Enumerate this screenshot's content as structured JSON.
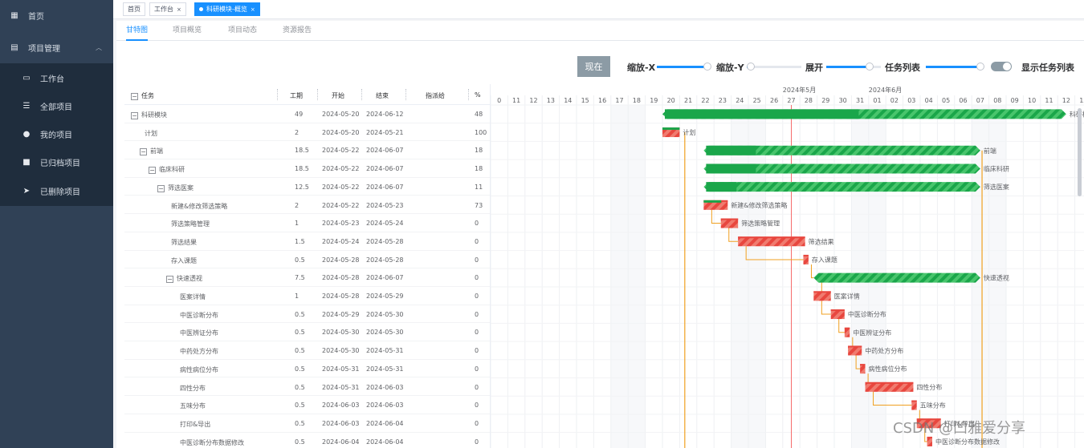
{
  "sidebar": {
    "items": [
      {
        "label": "首页",
        "icon": "dashboard-icon"
      },
      {
        "label": "项目管理",
        "icon": "document-icon"
      },
      {
        "label": "工作台",
        "icon": "monitor-icon"
      },
      {
        "label": "全部项目",
        "icon": "list-icon"
      },
      {
        "label": "我的项目",
        "icon": "user-icon"
      },
      {
        "label": "已归档项目",
        "icon": "lock-icon"
      },
      {
        "label": "已删除项目",
        "icon": "send-icon"
      }
    ]
  },
  "tags": [
    {
      "label": "首页"
    },
    {
      "label": "工作台",
      "close": "×"
    },
    {
      "label": "科研模块-概览",
      "close": "×"
    }
  ],
  "tabs": [
    {
      "label": "甘特图"
    },
    {
      "label": "项目概览"
    },
    {
      "label": "项目动态"
    },
    {
      "label": "资源报告"
    }
  ],
  "toolbar": {
    "now_label": "现在",
    "zoom_x_label": "缩放-X",
    "zoom_y_label": "缩放-Y",
    "expand_label": "展开",
    "task_list_label": "任务列表",
    "show_task_list_label": "显示任务列表",
    "zoom_x_value": 0.95,
    "zoom_y_value": 0.08,
    "expand_value": 0.8,
    "task_list_value": 0.95,
    "show_task_list": true
  },
  "grid": {
    "toggle_symbol": "−",
    "headers": {
      "task": "任务",
      "duration": "工期",
      "start": "开始",
      "end": "结束",
      "assignee": "指派给",
      "percent": "%"
    },
    "rows": [
      {
        "name": "科研模块",
        "level": 0,
        "toggle": true,
        "duration": "49",
        "start": "2024-05-20",
        "end": "2024-06-12",
        "percent": "48"
      },
      {
        "name": "计划",
        "level": 1,
        "toggle": false,
        "duration": "2",
        "start": "2024-05-20",
        "end": "2024-05-21",
        "percent": "100"
      },
      {
        "name": "前端",
        "level": 1,
        "toggle": true,
        "duration": "18.5",
        "start": "2024-05-22",
        "end": "2024-06-07",
        "percent": "18"
      },
      {
        "name": "临床科研",
        "level": 2,
        "toggle": true,
        "duration": "18.5",
        "start": "2024-05-22",
        "end": "2024-06-07",
        "percent": "18"
      },
      {
        "name": "筛选医案",
        "level": 3,
        "toggle": true,
        "duration": "12.5",
        "start": "2024-05-22",
        "end": "2024-06-07",
        "percent": "11"
      },
      {
        "name": "新建&修改筛选策略",
        "level": 4,
        "toggle": false,
        "duration": "2",
        "start": "2024-05-22",
        "end": "2024-05-23",
        "percent": "73"
      },
      {
        "name": "筛选策略管理",
        "level": 4,
        "toggle": false,
        "duration": "1",
        "start": "2024-05-23",
        "end": "2024-05-24",
        "percent": "0"
      },
      {
        "name": "筛选结果",
        "level": 4,
        "toggle": false,
        "duration": "1.5",
        "start": "2024-05-24",
        "end": "2024-05-28",
        "percent": "0"
      },
      {
        "name": "存入课题",
        "level": 4,
        "toggle": false,
        "duration": "0.5",
        "start": "2024-05-28",
        "end": "2024-05-28",
        "percent": "0"
      },
      {
        "name": "快速透视",
        "level": 4,
        "toggle": true,
        "duration": "7.5",
        "start": "2024-05-28",
        "end": "2024-06-07",
        "percent": "0"
      },
      {
        "name": "医案详情",
        "level": 5,
        "toggle": false,
        "duration": "1",
        "start": "2024-05-28",
        "end": "2024-05-29",
        "percent": "0"
      },
      {
        "name": "中医诊断分布",
        "level": 5,
        "toggle": false,
        "duration": "0.5",
        "start": "2024-05-29",
        "end": "2024-05-30",
        "percent": "0"
      },
      {
        "name": "中医辨证分布",
        "level": 5,
        "toggle": false,
        "duration": "0.5",
        "start": "2024-05-30",
        "end": "2024-05-30",
        "percent": "0"
      },
      {
        "name": "中药处方分布",
        "level": 5,
        "toggle": false,
        "duration": "0.5",
        "start": "2024-05-30",
        "end": "2024-05-31",
        "percent": "0"
      },
      {
        "name": "病性病位分布",
        "level": 5,
        "toggle": false,
        "duration": "0.5",
        "start": "2024-05-31",
        "end": "2024-05-31",
        "percent": "0"
      },
      {
        "name": "四性分布",
        "level": 5,
        "toggle": false,
        "duration": "0.5",
        "start": "2024-05-31",
        "end": "2024-06-03",
        "percent": "0"
      },
      {
        "name": "五味分布",
        "level": 5,
        "toggle": false,
        "duration": "0.5",
        "start": "2024-06-03",
        "end": "2024-06-03",
        "percent": "0"
      },
      {
        "name": "打印&导出",
        "level": 5,
        "toggle": false,
        "duration": "0.5",
        "start": "2024-06-03",
        "end": "2024-06-04",
        "percent": "0"
      },
      {
        "name": "中医诊断分布数据修改",
        "level": 5,
        "toggle": false,
        "duration": "0.5",
        "start": "2024-06-04",
        "end": "2024-06-04",
        "percent": "0"
      }
    ]
  },
  "timeline": {
    "month_labels": [
      {
        "label": "2024年5月",
        "day_index": 17
      },
      {
        "label": "2024年6月",
        "day_index": 22
      }
    ],
    "days": [
      "0",
      "11",
      "12",
      "13",
      "14",
      "15",
      "16",
      "17",
      "18",
      "19",
      "20",
      "21",
      "22",
      "23",
      "24",
      "25",
      "26",
      "27",
      "28",
      "29",
      "30",
      "31",
      "01",
      "02",
      "03",
      "04",
      "05",
      "06",
      "07",
      "08",
      "09",
      "10",
      "11",
      "12",
      "13"
    ],
    "today_index": 17.5,
    "colors": {
      "summary": "#1aa64a",
      "summary_light": "#48c56c",
      "task": "#e8473f",
      "task_light": "#f07b6f",
      "progress_task": "#1aa64a",
      "link": "#f0a020",
      "today": "#f56c6c"
    },
    "bars": [
      {
        "type": "summary",
        "start": 10,
        "end": 33.5,
        "label": "科研模块",
        "progress": 0.48
      },
      {
        "type": "task",
        "start": 10,
        "end": 11,
        "label": "计划",
        "progress": 1.0
      },
      {
        "type": "summary",
        "start": 12.4,
        "end": 28.5,
        "label": "前端",
        "progress": 0.18
      },
      {
        "type": "summary",
        "start": 12.4,
        "end": 28.5,
        "label": "临床科研",
        "progress": 0.18
      },
      {
        "type": "summary",
        "start": 12.4,
        "end": 28.5,
        "label": "筛选医案",
        "progress": 0.11
      },
      {
        "type": "task",
        "start": 12.4,
        "end": 13.8,
        "label": "新建&修改筛选策略",
        "progress": 0.73
      },
      {
        "type": "task",
        "start": 13.4,
        "end": 14.4,
        "label": "筛选策略管理",
        "progress": 0
      },
      {
        "type": "task",
        "start": 14.4,
        "end": 18.3,
        "label": "筛选结果",
        "progress": 0
      },
      {
        "type": "task",
        "start": 18.2,
        "end": 18.5,
        "label": "存入课题",
        "progress": 0
      },
      {
        "type": "summary",
        "start": 18.8,
        "end": 28.5,
        "label": "快速透视",
        "progress": 0
      },
      {
        "type": "task",
        "start": 18.8,
        "end": 19.8,
        "label": "医案详情",
        "progress": 0
      },
      {
        "type": "task",
        "start": 19.8,
        "end": 20.6,
        "label": "中医诊断分布",
        "progress": 0
      },
      {
        "type": "task",
        "start": 20.6,
        "end": 20.9,
        "label": "中医辨证分布",
        "progress": 0
      },
      {
        "type": "task",
        "start": 20.8,
        "end": 21.6,
        "label": "中药处方分布",
        "progress": 0
      },
      {
        "type": "task",
        "start": 21.5,
        "end": 21.8,
        "label": "病性病位分布",
        "progress": 0
      },
      {
        "type": "task",
        "start": 21.8,
        "end": 24.6,
        "label": "四性分布",
        "progress": 0
      },
      {
        "type": "task",
        "start": 24.5,
        "end": 24.8,
        "label": "五味分布",
        "progress": 0
      },
      {
        "type": "task",
        "start": 24.8,
        "end": 26.2,
        "label": "打印&导出",
        "progress": 0
      },
      {
        "type": "task",
        "start": 25.4,
        "end": 25.7,
        "label": "中医诊断分布数据修改",
        "progress": 0
      }
    ]
  },
  "watermark": "CSDN @凹雅爱分享"
}
